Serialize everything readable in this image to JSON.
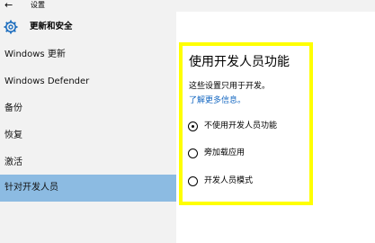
{
  "window": {
    "title": "设置"
  },
  "sidebar": {
    "header_title": "更新和安全",
    "items": [
      {
        "label": "Windows 更新"
      },
      {
        "label": "Windows Defender"
      },
      {
        "label": "备份"
      },
      {
        "label": "恢复"
      },
      {
        "label": "激活"
      },
      {
        "label": "针对开发人员",
        "selected": true
      }
    ]
  },
  "main": {
    "heading": "使用开发人员功能",
    "description": "这些设置只用于开发。",
    "learn_more_link": "了解更多信息。",
    "options": [
      {
        "label": "不使用开发人员功能",
        "checked": true
      },
      {
        "label": "旁加载应用",
        "checked": false
      },
      {
        "label": "开发人员模式",
        "checked": false
      }
    ]
  },
  "colors": {
    "selected_bg": "#8cbbe2",
    "link": "#1668c2",
    "highlight": "#ffff00"
  }
}
